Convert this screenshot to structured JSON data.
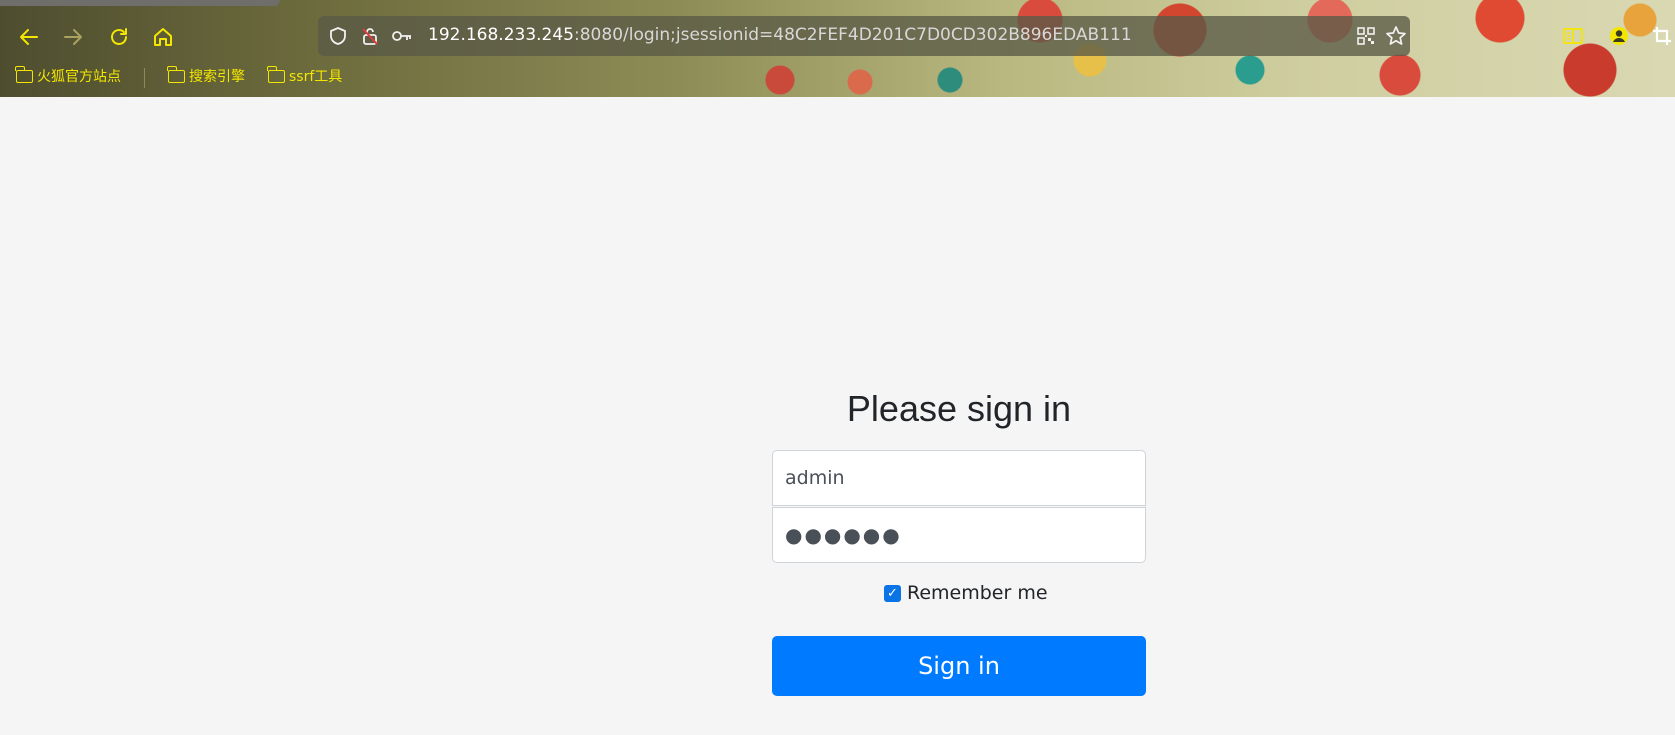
{
  "browser": {
    "url_host": "192.168.233.245",
    "url_rest": ":8080/login;jsessionid=48C2FEF4D201C7D0CD302B896EDAB111",
    "icons": {
      "back": "arrow-left-icon",
      "forward": "arrow-right-icon",
      "reload": "reload-icon",
      "home": "home-icon",
      "shield": "shield-icon",
      "lock": "lock-warning-icon",
      "key": "key-icon",
      "qr": "qr-code-icon",
      "bookmark_star": "star-icon",
      "reader": "reader-view-icon",
      "account": "account-icon",
      "crop": "crop-icon"
    },
    "bookmarks": [
      {
        "label": "火狐官方站点"
      },
      {
        "label": "搜索引擎"
      },
      {
        "label": "ssrf工具"
      }
    ],
    "accent_color": "#f3e600"
  },
  "login": {
    "title": "Please sign in",
    "username_value": "admin",
    "password_value": "●●●●●●",
    "remember_label": "Remember me",
    "remember_checked": true,
    "submit_label": "Sign in",
    "button_color": "#007bff"
  }
}
